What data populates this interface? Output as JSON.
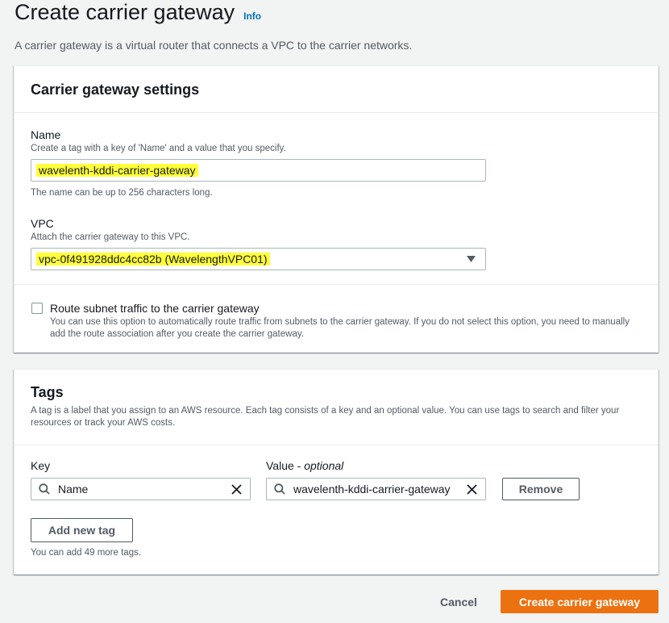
{
  "page": {
    "title": "Create carrier gateway",
    "info_label": "Info",
    "description": "A carrier gateway is a virtual router that connects a VPC to the carrier networks."
  },
  "settings": {
    "title": "Carrier gateway settings",
    "name_label": "Name",
    "name_hint": "Create a tag with a key of 'Name' and a value that you specify.",
    "name_value": "wavelenth-kddi-carrier-gateway",
    "name_constraint": "The name can be up to 256 characters long.",
    "vpc_label": "VPC",
    "vpc_hint": "Attach the carrier gateway to this VPC.",
    "vpc_value": "vpc-0f491928ddc4cc82b (WavelengthVPC01)",
    "route_label": "Route subnet traffic to the carrier gateway",
    "route_hint": "You can use this option to automatically route traffic from subnets to the carrier gateway. If you do not select this option, you need to manually add the route association after you create the carrier gateway.",
    "route_checked": false
  },
  "tags": {
    "title": "Tags",
    "description": "A tag is a label that you assign to an AWS resource. Each tag consists of a key and an optional value. You can use tags to search and filter your resources or track your AWS costs.",
    "key_header": "Key",
    "value_header": "Value -",
    "value_optional": "optional",
    "rows": [
      {
        "key": "Name",
        "value": "wavelenth-kddi-carrier-gateway",
        "remove_label": "Remove"
      }
    ],
    "add_label": "Add new tag",
    "remaining": "You can add 49 more tags."
  },
  "footer": {
    "cancel_label": "Cancel",
    "create_label": "Create carrier gateway"
  },
  "colors": {
    "primary": "#ec7211",
    "link": "#0073bb",
    "highlight": "#ffff3a"
  }
}
